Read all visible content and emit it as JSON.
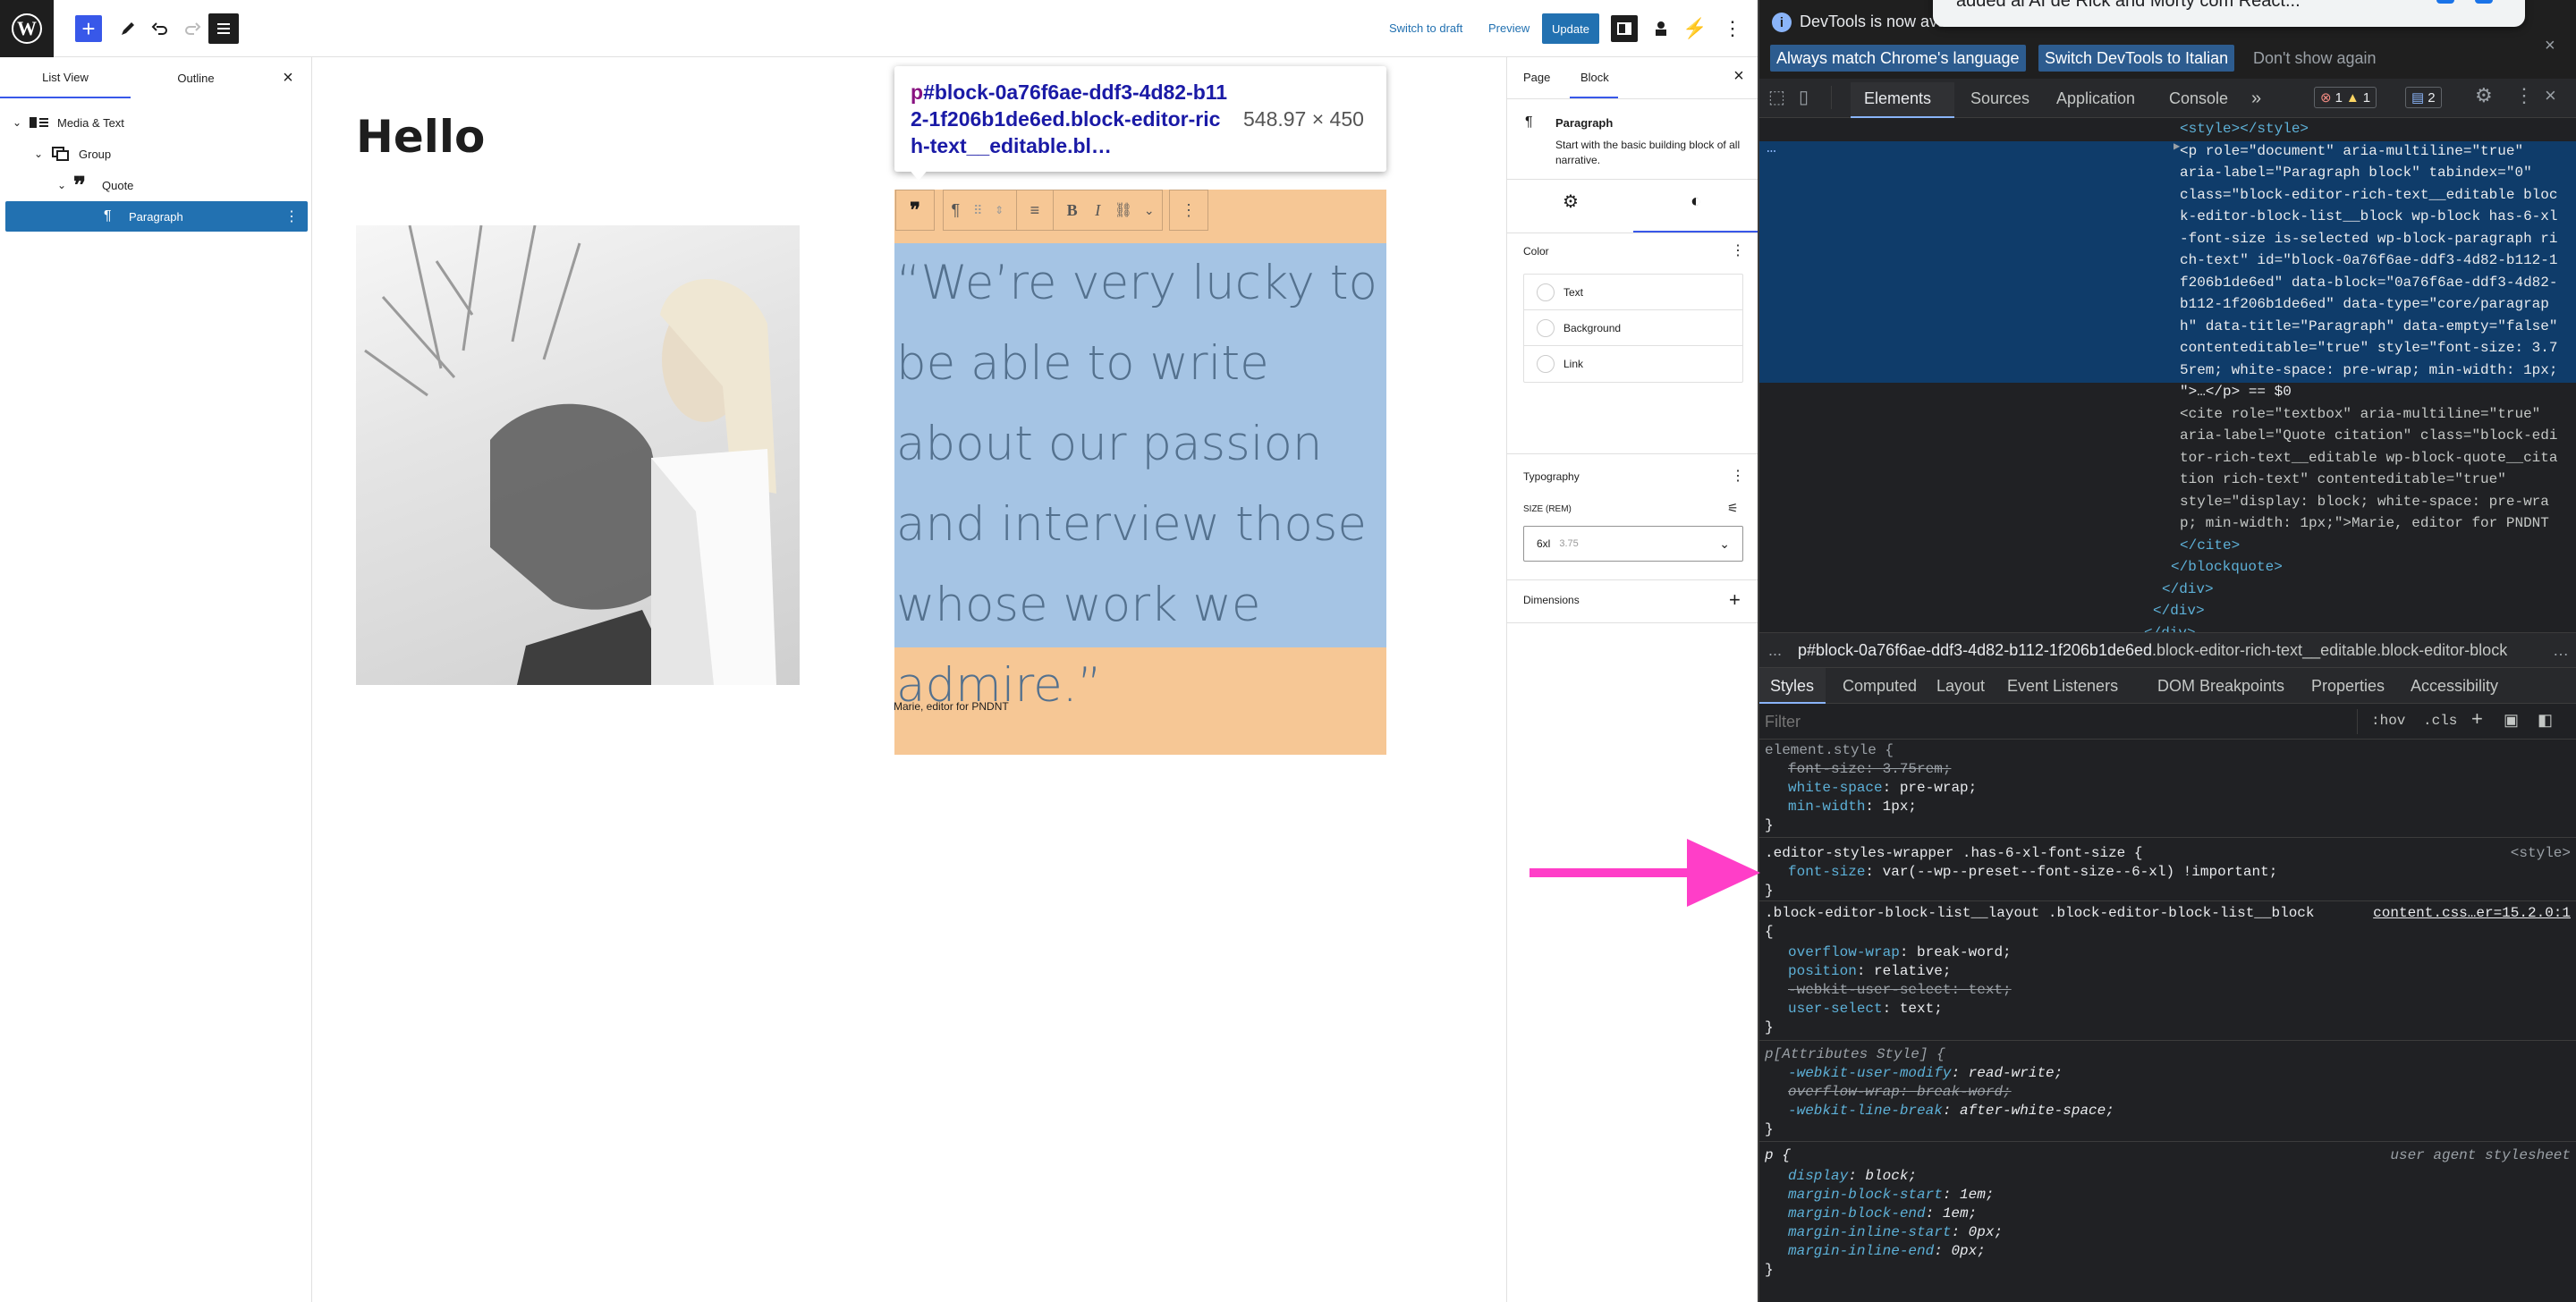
{
  "topbar": {
    "switch_to_draft": "Switch to draft",
    "preview": "Preview",
    "update": "Update"
  },
  "listview": {
    "tab_list": "List View",
    "tab_outline": "Outline",
    "items": [
      {
        "label": "Media & Text"
      },
      {
        "label": "Group"
      },
      {
        "label": "Quote"
      },
      {
        "label": "Paragraph"
      }
    ]
  },
  "canvas": {
    "title": "Hello",
    "quote_text": "“We’re very lucky to be able to write about our passion and interview those whose work we admire.”",
    "citation": "Marie, editor for PNDNT",
    "tooltip_selector_tag": "p",
    "tooltip_selector_rest": "#block-0a76f6ae-ddf3-4d82-b112-1f206b1de6ed.block-editor-rich-text__editable.bl…",
    "tooltip_size": "548.97 × 450"
  },
  "settings": {
    "tab_page": "Page",
    "tab_block": "Block",
    "block_name": "Paragraph",
    "block_desc": "Start with the basic building block of all narrative.",
    "color_heading": "Color",
    "color_items": [
      "Text",
      "Background",
      "Link"
    ],
    "typography_heading": "Typography",
    "size_label": "SIZE (REM)",
    "size_value": "6xl",
    "size_sub": "3.75",
    "dimensions_heading": "Dimensions"
  },
  "devtools": {
    "notice": "DevTools is now ava",
    "btn_match": "Always match Chrome's language",
    "btn_switch": "Switch DevTools to Italian",
    "btn_dont": "Don't show again",
    "overlay_text": "added ai AI de Rick and Morty com React...",
    "tabs": [
      "Elements",
      "Sources",
      "Application",
      "Console"
    ],
    "errors": "1",
    "warnings": "1",
    "messages": "2",
    "dom_lines": [
      "<style></style>",
      "<p role=\"document\" aria-multiline=\"true\"",
      "aria-label=\"Paragraph block\" tabindex=\"0\"",
      "class=\"block-editor-rich-text__editable bloc",
      "k-editor-block-list__block wp-block has-6-xl",
      "-font-size is-selected wp-block-paragraph ri",
      "ch-text\" id=\"block-0a76f6ae-ddf3-4d82-b112-1",
      "f206b1de6ed\" data-block=\"0a76f6ae-ddf3-4d82-",
      "b112-1f206b1de6ed\" data-type=\"core/paragrap",
      "h\" data-title=\"Paragraph\" data-empty=\"false\"",
      "contenteditable=\"true\" style=\"font-size: 3.7",
      "5rem; white-space: pre-wrap; min-width: 1px;",
      "\">…</p> == $0",
      "<cite role=\"textbox\" aria-multiline=\"true\"",
      "aria-label=\"Quote citation\" class=\"block-edi",
      "tor-rich-text__editable wp-block-quote__cita",
      "tion rich-text\" contenteditable=\"true\"",
      "style=\"display: block; white-space: pre-wra",
      "p; min-width: 1px;\">Marie, editor for PNDNT",
      "</cite>",
      "</blockquote>",
      "</div>",
      "</div>",
      "</div>",
      "</div>"
    ],
    "breadcrumb_dots": "...",
    "breadcrumb_tag": "p",
    "breadcrumb_id": "#block-0a76f6ae-ddf3-4d82-b112-1f206b1de6ed",
    "breadcrumb_classes": ".block-editor-rich-text__editable.block-editor-block",
    "style_tabs": [
      "Styles",
      "Computed",
      "Layout",
      "Event Listeners",
      "DOM Breakpoints",
      "Properties",
      "Accessibility"
    ],
    "filter_placeholder": "Filter",
    "hov": ":hov",
    "cls": ".cls",
    "rules": {
      "r1_selector": "element.style {",
      "r1_p1_name": "font-size",
      "r1_p1_value": "3.75rem;",
      "r1_p2_name": "white-space",
      "r1_p2_value": "pre-wrap;",
      "r1_p3_name": "min-width",
      "r1_p3_value": "1px;",
      "r2_selector": ".editor-styles-wrapper .has-6-xl-font-size {",
      "r2_source": "<style>",
      "r2_p1_name": "font-size",
      "r2_p1_value": "var(--wp--preset--font-size--6-xl) !important;",
      "r3_selector": ".block-editor-block-list__layout .block-editor-block-list__block",
      "r3_source": "content.css…er=15.2.0:1",
      "r3_p1_name": "overflow-wrap",
      "r3_p1_value": "break-word;",
      "r3_p2_name": "position",
      "r3_p2_value": "relative;",
      "r3_p3_name": "-webkit-user-select",
      "r3_p3_value": "text;",
      "r3_p4_name": "user-select",
      "r3_p4_value": "text;",
      "r4_selector": "p[Attributes Style] {",
      "r4_p1_name": "-webkit-user-modify",
      "r4_p1_value": "read-write;",
      "r4_p2_name": "overflow-wrap",
      "r4_p2_value": "break-word;",
      "r4_p3_name": "-webkit-line-break",
      "r4_p3_value": "after-white-space;",
      "r5_selector": "p {",
      "r5_source": "user agent stylesheet",
      "r5_p1_name": "display",
      "r5_p1_value": "block;",
      "r5_p2_name": "margin-block-start",
      "r5_p2_value": "1em;",
      "r5_p3_name": "margin-block-end",
      "r5_p3_value": "1em;",
      "r5_p4_name": "margin-inline-start",
      "r5_p4_value": "0px;",
      "r5_p5_name": "margin-inline-end",
      "r5_p5_value": "0px;"
    },
    "brace_open": "{",
    "brace_close": "}"
  },
  "annotation_color": "#ff3ec8"
}
